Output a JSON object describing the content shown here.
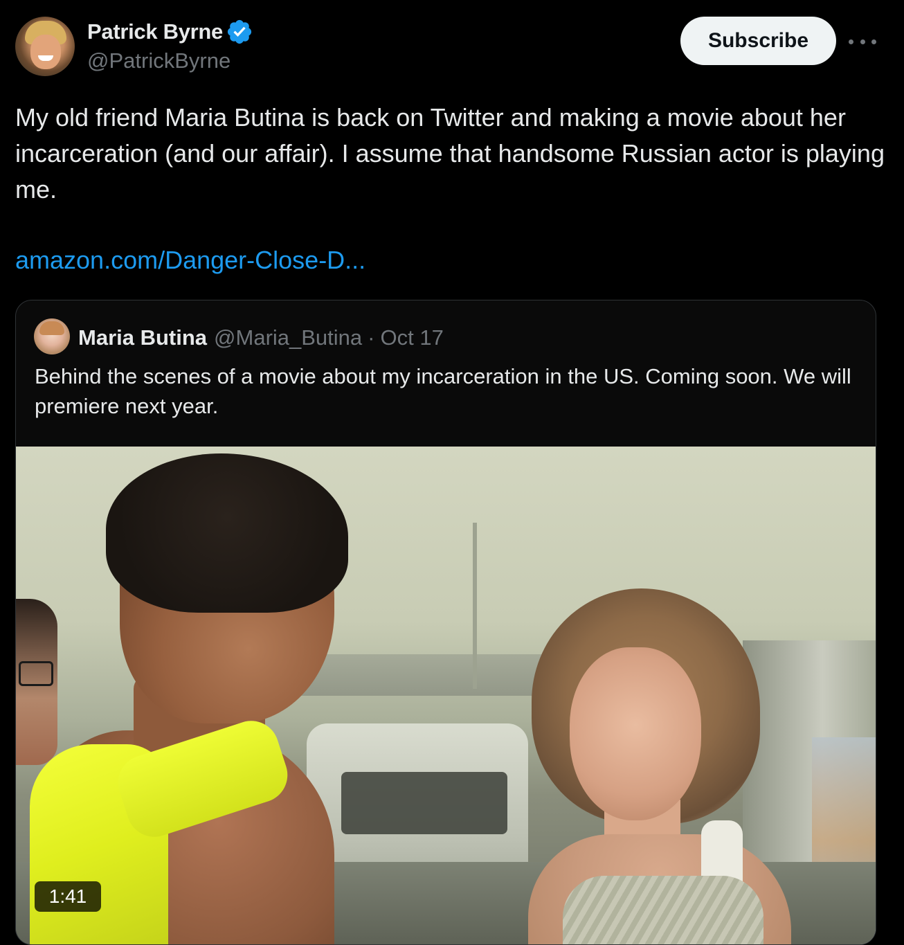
{
  "author": {
    "name": "Patrick Byrne",
    "handle": "@PatrickByrne",
    "verified": true
  },
  "actions": {
    "subscribe_label": "Subscribe",
    "more_icon": "more-horizontal-icon"
  },
  "tweet": {
    "text": "My old friend Maria Butina is back on Twitter and making a movie about her incarceration (and our affair). I assume that handsome Russian actor is playing me.",
    "link": "amazon.com/Danger-Close-D..."
  },
  "quoted_tweet": {
    "name": "Maria Butina",
    "handle": "@Maria_Butina",
    "separator": "·",
    "date": "Oct 17",
    "text": "Behind the scenes of a movie about my incarceration in the US. Coming soon. We will premiere next year.",
    "video": {
      "duration": "1:41"
    }
  },
  "colors": {
    "background": "#000000",
    "text": "#e7e9ea",
    "muted": "#71767b",
    "link": "#1d9bf0",
    "verified": "#1d9bf0",
    "subscribe_bg": "#eff3f4",
    "border": "#2f3336"
  }
}
